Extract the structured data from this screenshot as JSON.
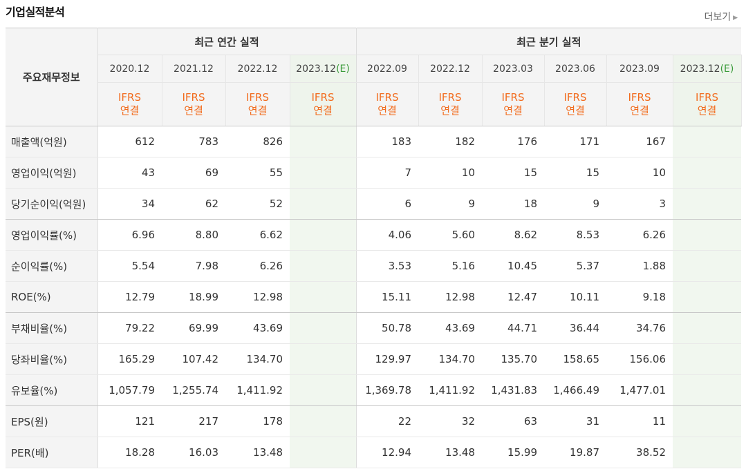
{
  "section_title": "기업실적분석",
  "more_label": "더보기",
  "more_arrow": "▶",
  "header": {
    "row_label": "주요재무정보",
    "annual_group": "최근 연간 실적",
    "quarter_group": "최근 분기 실적",
    "annual_periods": [
      "2020.12",
      "2021.12",
      "2022.12",
      "2023.12"
    ],
    "quarter_periods": [
      "2022.09",
      "2022.12",
      "2023.03",
      "2023.06",
      "2023.09",
      "2023.12"
    ],
    "estimate_mark": "(E)",
    "acct_line1": "IFRS",
    "acct_line2": "연결"
  },
  "rows": [
    {
      "label": "매출액(억원)",
      "annual": [
        "612",
        "783",
        "826",
        ""
      ],
      "quarter": [
        "183",
        "182",
        "176",
        "171",
        "167",
        ""
      ]
    },
    {
      "label": "영업이익(억원)",
      "annual": [
        "43",
        "69",
        "55",
        ""
      ],
      "quarter": [
        "7",
        "10",
        "15",
        "15",
        "10",
        ""
      ]
    },
    {
      "label": "당기순이익(억원)",
      "annual": [
        "34",
        "62",
        "52",
        ""
      ],
      "quarter": [
        "6",
        "9",
        "18",
        "9",
        "3",
        ""
      ]
    },
    {
      "label": "영업이익률(%)",
      "annual": [
        "6.96",
        "8.80",
        "6.62",
        ""
      ],
      "quarter": [
        "4.06",
        "5.60",
        "8.62",
        "8.53",
        "6.26",
        ""
      ]
    },
    {
      "label": "순이익률(%)",
      "annual": [
        "5.54",
        "7.98",
        "6.26",
        ""
      ],
      "quarter": [
        "3.53",
        "5.16",
        "10.45",
        "5.37",
        "1.88",
        ""
      ]
    },
    {
      "label": "ROE(%)",
      "annual": [
        "12.79",
        "18.99",
        "12.98",
        ""
      ],
      "quarter": [
        "15.11",
        "12.98",
        "12.47",
        "10.11",
        "9.18",
        ""
      ]
    },
    {
      "label": "부채비율(%)",
      "annual": [
        "79.22",
        "69.99",
        "43.69",
        ""
      ],
      "quarter": [
        "50.78",
        "43.69",
        "44.71",
        "36.44",
        "34.76",
        ""
      ]
    },
    {
      "label": "당좌비율(%)",
      "annual": [
        "165.29",
        "107.42",
        "134.70",
        ""
      ],
      "quarter": [
        "129.97",
        "134.70",
        "135.70",
        "158.65",
        "156.06",
        ""
      ]
    },
    {
      "label": "유보율(%)",
      "annual": [
        "1,057.79",
        "1,255.74",
        "1,411.92",
        ""
      ],
      "quarter": [
        "1,369.78",
        "1,411.92",
        "1,431.83",
        "1,466.49",
        "1,477.01",
        ""
      ]
    },
    {
      "label": "EPS(원)",
      "annual": [
        "121",
        "217",
        "178",
        ""
      ],
      "quarter": [
        "22",
        "32",
        "63",
        "31",
        "11",
        ""
      ]
    },
    {
      "label": "PER(배)",
      "annual": [
        "18.28",
        "16.03",
        "13.48",
        ""
      ],
      "quarter": [
        "12.94",
        "13.48",
        "15.99",
        "19.87",
        "38.52",
        ""
      ]
    }
  ],
  "colors": {
    "accent_orange": "#f26b1d",
    "estimate_green": "#3a9b3a",
    "estimate_bg": "#f1f7ef",
    "header_bg": "#f4f4f4"
  }
}
